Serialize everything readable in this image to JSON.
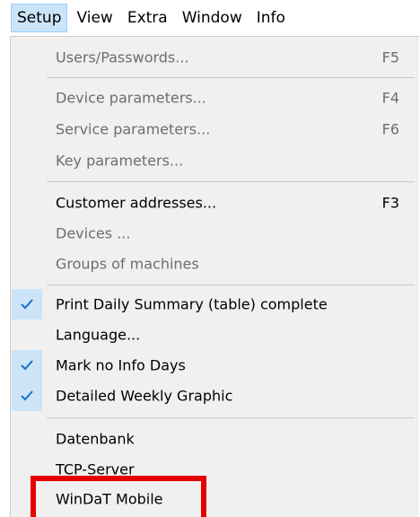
{
  "menubar": {
    "items": [
      {
        "label": "Setup",
        "active": true
      },
      {
        "label": "View"
      },
      {
        "label": "Extra"
      },
      {
        "label": "Window"
      },
      {
        "label": "Info"
      }
    ]
  },
  "menu": {
    "users_passwords": {
      "label": "Users/Passwords...",
      "shortcut": "F5",
      "enabled": false
    },
    "device_parameters": {
      "label": "Device parameters...",
      "shortcut": "F4",
      "enabled": false
    },
    "service_parameters": {
      "label": "Service parameters...",
      "shortcut": "F6",
      "enabled": false
    },
    "key_parameters": {
      "label": "Key parameters...",
      "enabled": false
    },
    "customer_addresses": {
      "label": "Customer addresses...",
      "shortcut": "F3",
      "enabled": true
    },
    "devices": {
      "label": "Devices ...",
      "enabled": false
    },
    "groups_of_machines": {
      "label": "Groups of machines",
      "enabled": false
    },
    "print_daily_summary": {
      "label": "Print Daily Summary (table) complete",
      "checked": true,
      "enabled": true
    },
    "language": {
      "label": "Language...",
      "enabled": true
    },
    "mark_no_info_days": {
      "label": "Mark no Info Days",
      "checked": true,
      "enabled": true
    },
    "detailed_weekly_graphic": {
      "label": "Detailed Weekly Graphic",
      "checked": true,
      "enabled": true
    },
    "datenbank": {
      "label": "Datenbank",
      "enabled": true
    },
    "tcp_server": {
      "label": "TCP-Server",
      "enabled": true
    },
    "windat_mobile": {
      "label": "WinDaT Mobile",
      "enabled": true,
      "highlighted": true
    }
  },
  "colors": {
    "menu_background": "#f0f0f0",
    "check_background": "#cce4f7",
    "check_mark": "#1a6fc9",
    "highlight_border": "#e50000",
    "disabled_text": "#6d6d6d"
  },
  "icons": {
    "check": "checkmark-icon"
  }
}
